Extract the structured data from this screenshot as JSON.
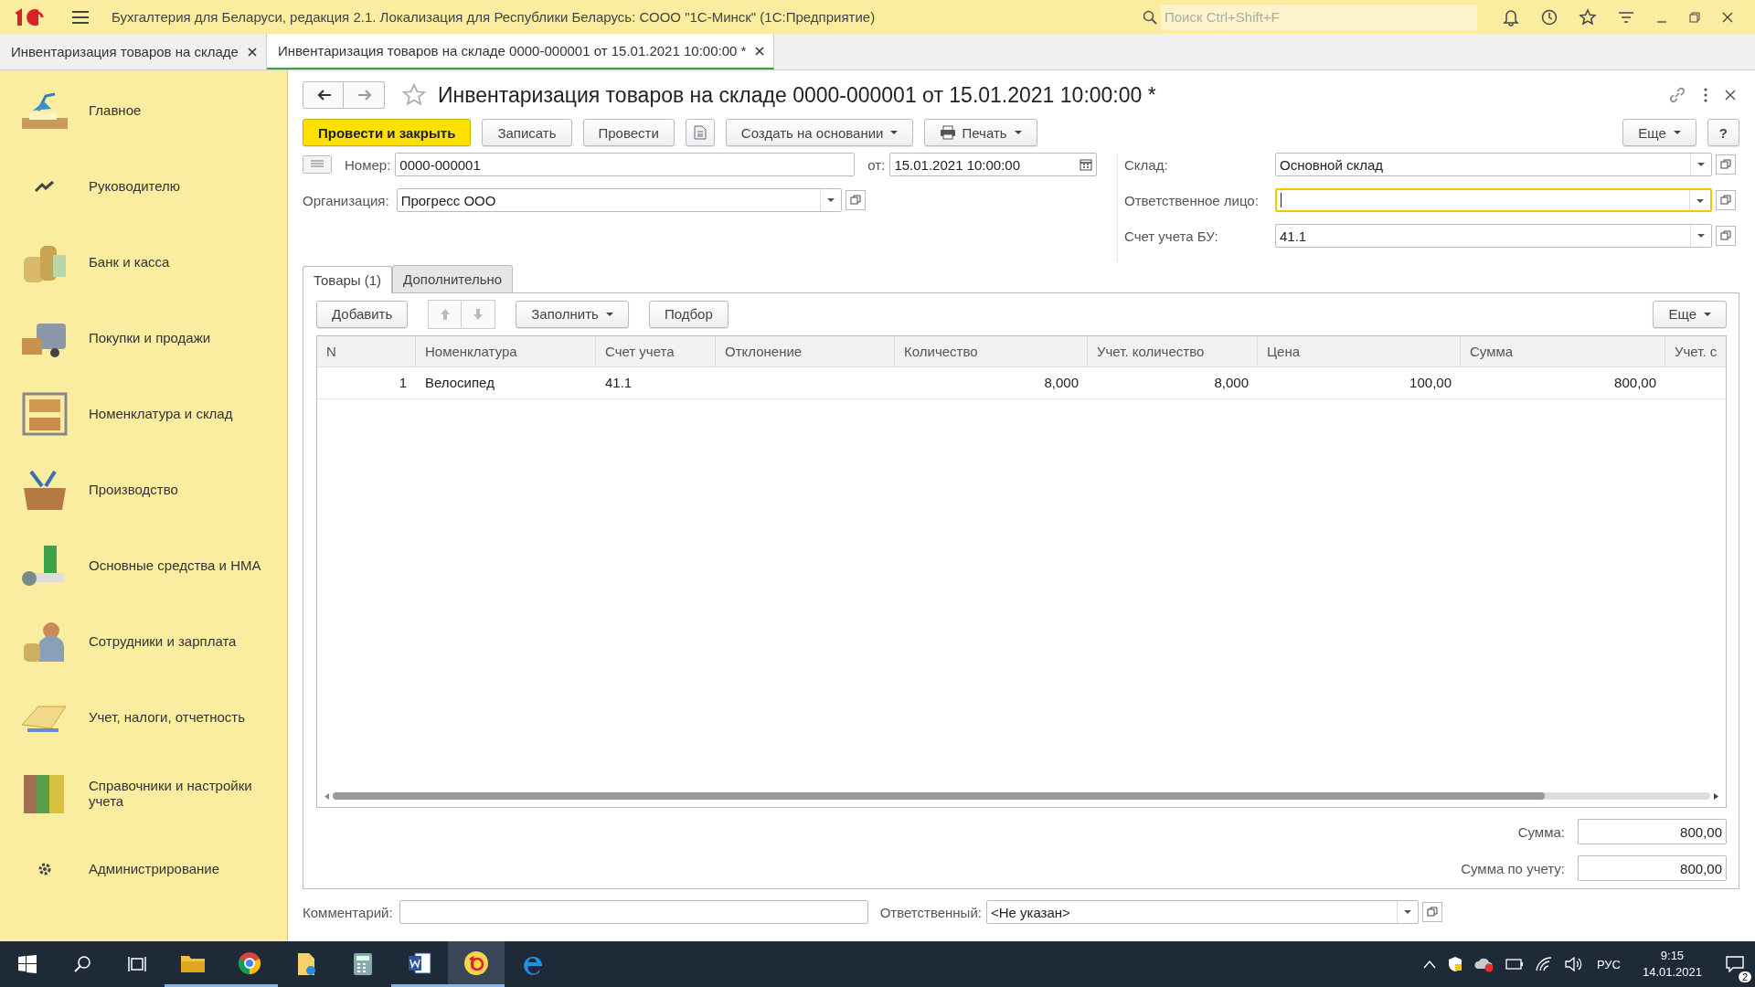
{
  "app_title": "Бухгалтерия для Беларуси, редакция 2.1. Локализация для Республики Беларусь: СООО \"1С-Минск\"  (1С:Предприятие)",
  "search": {
    "placeholder": "Поиск Ctrl+Shift+F"
  },
  "open_tabs": [
    {
      "label": "Инвентаризация товаров на складе",
      "selected": false
    },
    {
      "label": "Инвентаризация товаров на складе 0000-000001 от 15.01.2021 10:00:00 *",
      "selected": true
    }
  ],
  "sections": [
    {
      "label": "Главное"
    },
    {
      "label": "Руководителю"
    },
    {
      "label": "Банк и касса"
    },
    {
      "label": "Покупки и продажи"
    },
    {
      "label": "Номенклатура и склад"
    },
    {
      "label": "Производство"
    },
    {
      "label": "Основные средства и НМА"
    },
    {
      "label": "Сотрудники и зарплата"
    },
    {
      "label": "Учет, налоги, отчетность"
    },
    {
      "label": "Справочники и настройки учета"
    },
    {
      "label": "Администрирование"
    }
  ],
  "form": {
    "title": "Инвентаризация товаров на складе 0000-000001 от 15.01.2021 10:00:00 *",
    "buttons": [
      {
        "kind": "primary",
        "label": "Провести и закрыть"
      },
      {
        "kind": "plain",
        "label": "Записать"
      },
      {
        "kind": "plain",
        "label": "Провести"
      },
      {
        "kind": "icon"
      },
      {
        "kind": "dropdown",
        "label": "Создать на основании"
      },
      {
        "kind": "print",
        "label": "Печать"
      }
    ],
    "more": "Еще",
    "help": "?",
    "number": {
      "label": "Номер:",
      "value": "0000-000001"
    },
    "date": {
      "label": "от:",
      "value": "15.01.2021 10:00:00"
    },
    "organization": {
      "label": "Организация:",
      "value": "Прогресс ООО"
    },
    "right_fields": [
      {
        "label": "Склад:",
        "value": "Основной склад",
        "focused": false
      },
      {
        "label": "Ответственное лицо:",
        "focused": true
      },
      {
        "label": "Счет учета БУ:",
        "value": "41.1",
        "focused": false
      }
    ],
    "tabs": [
      {
        "label": "Товары (1)",
        "selected": true
      },
      {
        "label": "Дополнительно",
        "selected": false
      }
    ],
    "table_toolbar": {
      "add": "Добавить",
      "fill": "Заполнить",
      "pick": "Подбор",
      "more": "Еще"
    },
    "table": {
      "columns": [
        "N",
        "Номенклатура",
        "Счет учета",
        "Отклонение",
        "Количество",
        "Учет. количество",
        "Цена",
        "Сумма",
        "Учет. с"
      ],
      "rows": [
        {
          "cells": [
            "1",
            "Велосипед",
            "41.1",
            null,
            "8,000",
            "8,000",
            "100,00",
            "800,00",
            null
          ]
        }
      ]
    },
    "totals": [
      {
        "label": "Сумма:",
        "value": "800,00"
      },
      {
        "label": "Сумма по учету:",
        "value": "800,00"
      }
    ],
    "comment": {
      "label": "Комментарий:"
    },
    "responsible": {
      "label": "Ответственный:",
      "value": "<Не указан>"
    }
  },
  "taskbar": {
    "language": "РУС",
    "time": "9:15",
    "date": "14.01.2021",
    "notifications": "2"
  }
}
